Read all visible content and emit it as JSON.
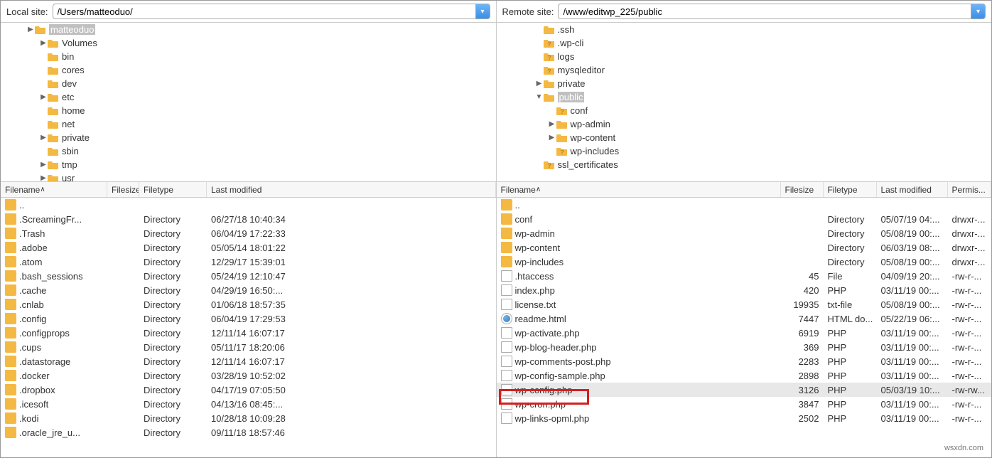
{
  "local": {
    "label": "Local site:",
    "path": "/Users/matteoduo/",
    "tree": [
      {
        "indent": 2,
        "toggle": "▶",
        "icon": "folder",
        "name": "matteoduo",
        "sel": true
      },
      {
        "indent": 3,
        "toggle": "▶",
        "icon": "folder",
        "name": "Volumes"
      },
      {
        "indent": 3,
        "toggle": "",
        "icon": "folder",
        "name": "bin"
      },
      {
        "indent": 3,
        "toggle": "",
        "icon": "folder",
        "name": "cores"
      },
      {
        "indent": 3,
        "toggle": "",
        "icon": "folder",
        "name": "dev"
      },
      {
        "indent": 3,
        "toggle": "▶",
        "icon": "folder",
        "name": "etc"
      },
      {
        "indent": 3,
        "toggle": "",
        "icon": "folder",
        "name": "home"
      },
      {
        "indent": 3,
        "toggle": "",
        "icon": "folder",
        "name": "net"
      },
      {
        "indent": 3,
        "toggle": "▶",
        "icon": "folder",
        "name": "private"
      },
      {
        "indent": 3,
        "toggle": "",
        "icon": "folder",
        "name": "sbin"
      },
      {
        "indent": 3,
        "toggle": "▶",
        "icon": "folder",
        "name": "tmp"
      },
      {
        "indent": 3,
        "toggle": "▶",
        "icon": "folder",
        "name": "usr"
      }
    ],
    "columns": {
      "name": "Filename",
      "size": "Filesize",
      "type": "Filetype",
      "mod": "Last modified"
    },
    "files": [
      {
        "icon": "folder",
        "name": "..",
        "size": "",
        "type": "",
        "mod": ""
      },
      {
        "icon": "folder",
        "name": ".ScreamingFr...",
        "size": "",
        "type": "Directory",
        "mod": "06/27/18 10:40:34"
      },
      {
        "icon": "folder",
        "name": ".Trash",
        "size": "",
        "type": "Directory",
        "mod": "06/04/19 17:22:33"
      },
      {
        "icon": "folder",
        "name": ".adobe",
        "size": "",
        "type": "Directory",
        "mod": "05/05/14 18:01:22"
      },
      {
        "icon": "folder",
        "name": ".atom",
        "size": "",
        "type": "Directory",
        "mod": "12/29/17 15:39:01"
      },
      {
        "icon": "folder",
        "name": ".bash_sessions",
        "size": "",
        "type": "Directory",
        "mod": "05/24/19 12:10:47"
      },
      {
        "icon": "folder",
        "name": ".cache",
        "size": "",
        "type": "Directory",
        "mod": "04/29/19 16:50:..."
      },
      {
        "icon": "folder",
        "name": ".cnlab",
        "size": "",
        "type": "Directory",
        "mod": "01/06/18 18:57:35"
      },
      {
        "icon": "folder",
        "name": ".config",
        "size": "",
        "type": "Directory",
        "mod": "06/04/19 17:29:53"
      },
      {
        "icon": "folder",
        "name": ".configprops",
        "size": "",
        "type": "Directory",
        "mod": "12/11/14 16:07:17"
      },
      {
        "icon": "folder",
        "name": ".cups",
        "size": "",
        "type": "Directory",
        "mod": "05/11/17 18:20:06"
      },
      {
        "icon": "folder",
        "name": ".datastorage",
        "size": "",
        "type": "Directory",
        "mod": "12/11/14 16:07:17"
      },
      {
        "icon": "folder",
        "name": ".docker",
        "size": "",
        "type": "Directory",
        "mod": "03/28/19 10:52:02"
      },
      {
        "icon": "folder",
        "name": ".dropbox",
        "size": "",
        "type": "Directory",
        "mod": "04/17/19 07:05:50"
      },
      {
        "icon": "folder",
        "name": ".icesoft",
        "size": "",
        "type": "Directory",
        "mod": "04/13/16 08:45:..."
      },
      {
        "icon": "folder",
        "name": ".kodi",
        "size": "",
        "type": "Directory",
        "mod": "10/28/18 10:09:28"
      },
      {
        "icon": "folder",
        "name": ".oracle_jre_u...",
        "size": "",
        "type": "Directory",
        "mod": "09/11/18 18:57:46"
      }
    ]
  },
  "remote": {
    "label": "Remote site:",
    "path": "/www/editwp_225/public",
    "tree": [
      {
        "indent": 3,
        "toggle": "",
        "icon": "folder",
        "name": ".ssh"
      },
      {
        "indent": 3,
        "toggle": "",
        "icon": "folderq",
        "name": ".wp-cli"
      },
      {
        "indent": 3,
        "toggle": "",
        "icon": "folderq",
        "name": "logs"
      },
      {
        "indent": 3,
        "toggle": "",
        "icon": "folderq",
        "name": "mysqleditor"
      },
      {
        "indent": 3,
        "toggle": "▶",
        "icon": "folder",
        "name": "private"
      },
      {
        "indent": 3,
        "toggle": "▼",
        "icon": "folder",
        "name": "public",
        "sel": true
      },
      {
        "indent": 4,
        "toggle": "",
        "icon": "folderq",
        "name": "conf"
      },
      {
        "indent": 4,
        "toggle": "▶",
        "icon": "folder",
        "name": "wp-admin"
      },
      {
        "indent": 4,
        "toggle": "▶",
        "icon": "folder",
        "name": "wp-content"
      },
      {
        "indent": 4,
        "toggle": "",
        "icon": "folderq",
        "name": "wp-includes"
      },
      {
        "indent": 3,
        "toggle": "",
        "icon": "folderq",
        "name": "ssl_certificates"
      }
    ],
    "columns": {
      "name": "Filename",
      "size": "Filesize",
      "type": "Filetype",
      "mod": "Last modified",
      "perm": "Permis..."
    },
    "files": [
      {
        "icon": "folder",
        "name": "..",
        "size": "",
        "type": "",
        "mod": "",
        "perm": ""
      },
      {
        "icon": "folder",
        "name": "conf",
        "size": "",
        "type": "Directory",
        "mod": "05/07/19 04:...",
        "perm": "drwxr-..."
      },
      {
        "icon": "folder",
        "name": "wp-admin",
        "size": "",
        "type": "Directory",
        "mod": "05/08/19 00:...",
        "perm": "drwxr-..."
      },
      {
        "icon": "folder",
        "name": "wp-content",
        "size": "",
        "type": "Directory",
        "mod": "06/03/19 08:...",
        "perm": "drwxr-..."
      },
      {
        "icon": "folder",
        "name": "wp-includes",
        "size": "",
        "type": "Directory",
        "mod": "05/08/19 00:...",
        "perm": "drwxr-..."
      },
      {
        "icon": "file",
        "name": ".htaccess",
        "size": "45",
        "type": "File",
        "mod": "04/09/19 20:...",
        "perm": "-rw-r-..."
      },
      {
        "icon": "file",
        "name": "index.php",
        "size": "420",
        "type": "PHP",
        "mod": "03/11/19 00:...",
        "perm": "-rw-r-..."
      },
      {
        "icon": "file",
        "name": "license.txt",
        "size": "19935",
        "type": "txt-file",
        "mod": "05/08/19 00:...",
        "perm": "-rw-r-..."
      },
      {
        "icon": "html",
        "name": "readme.html",
        "size": "7447",
        "type": "HTML do...",
        "mod": "05/22/19 06:...",
        "perm": "-rw-r-..."
      },
      {
        "icon": "file",
        "name": "wp-activate.php",
        "size": "6919",
        "type": "PHP",
        "mod": "03/11/19 00:...",
        "perm": "-rw-r-..."
      },
      {
        "icon": "file",
        "name": "wp-blog-header.php",
        "size": "369",
        "type": "PHP",
        "mod": "03/11/19 00:...",
        "perm": "-rw-r-..."
      },
      {
        "icon": "file",
        "name": "wp-comments-post.php",
        "size": "2283",
        "type": "PHP",
        "mod": "03/11/19 00:...",
        "perm": "-rw-r-..."
      },
      {
        "icon": "file",
        "name": "wp-config-sample.php",
        "size": "2898",
        "type": "PHP",
        "mod": "03/11/19 00:...",
        "perm": "-rw-r-..."
      },
      {
        "icon": "file",
        "name": "wp-config.php",
        "size": "3126",
        "type": "PHP",
        "mod": "05/03/19 10:...",
        "perm": "-rw-rw...",
        "hl": true
      },
      {
        "icon": "file",
        "name": "wp-cron.php",
        "size": "3847",
        "type": "PHP",
        "mod": "03/11/19 00:...",
        "perm": "-rw-r-..."
      },
      {
        "icon": "file",
        "name": "wp-links-opml.php",
        "size": "2502",
        "type": "PHP",
        "mod": "03/11/19 00:...",
        "perm": "-rw-r-..."
      }
    ]
  },
  "watermark": "wsxdn.com"
}
